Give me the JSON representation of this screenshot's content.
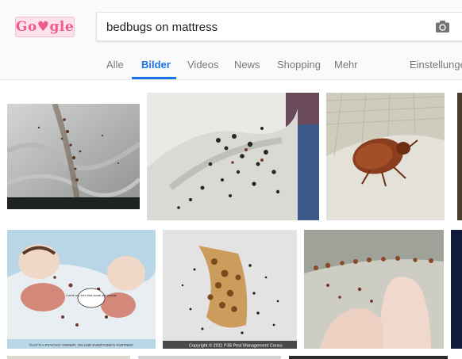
{
  "logo": {
    "text": "Go♥gle"
  },
  "search": {
    "query": "bedbugs on mattress"
  },
  "icons": {
    "camera": "camera-icon"
  },
  "tabs": [
    {
      "label": "Alle"
    },
    {
      "label": "Bilder",
      "active": true
    },
    {
      "label": "Videos"
    },
    {
      "label": "News"
    },
    {
      "label": "Shopping"
    },
    {
      "label": "Mehr"
    },
    {
      "label": "Einstellungen"
    }
  ],
  "results": {
    "row1": [
      "mattress-seam-image",
      "bedbugs-fabric-closeup-image",
      "bedbug-on-fabric-image",
      "partial-image"
    ],
    "row2": [
      "bedbug-cartoon-image",
      "bedbug-cluster-image",
      "bedbugs-on-finger-image",
      "partial-image"
    ]
  },
  "captions": {
    "cartoon_credit": "THAT'S A PSYCHIC OWNER, ON AND EVERYONE'S PARTNER",
    "cartoon_speech": "Come on, let's find some out people",
    "cluster_credit": "Copyright © 2011 PJB Pest Management Consu"
  },
  "colors": {
    "accent": "#1a73e8",
    "header_bg": "#fafafa"
  }
}
